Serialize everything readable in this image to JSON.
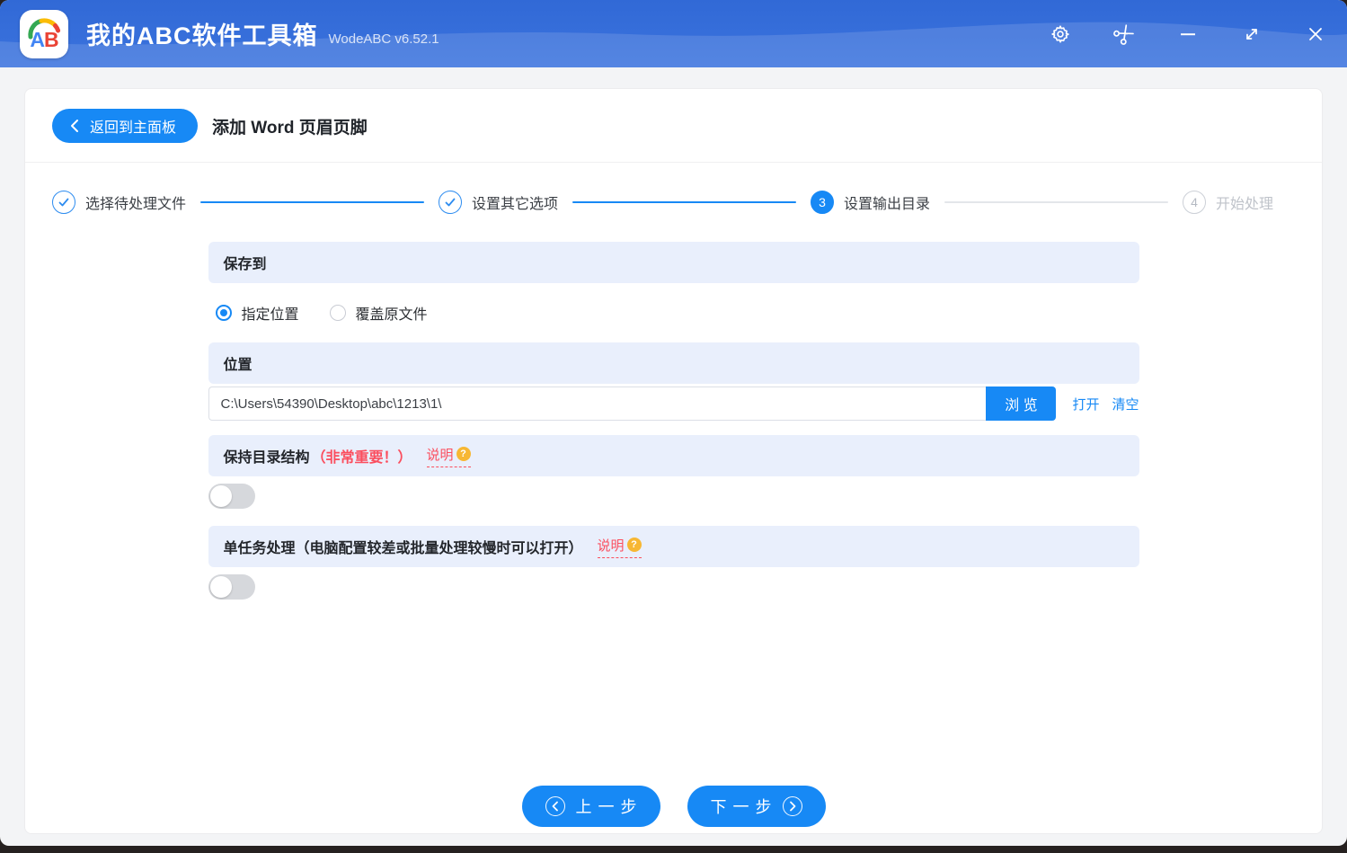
{
  "window": {
    "title": "我的ABC软件工具箱",
    "version": "WodeABC v6.52.1",
    "logo_a": "A",
    "logo_b": "B"
  },
  "titlebar": {
    "icons": [
      "settings-gear",
      "scissors-screenshot",
      "minimize",
      "resize",
      "close"
    ]
  },
  "header": {
    "back_label": "返回到主面板",
    "page_title": "添加 Word 页眉页脚"
  },
  "steps": [
    {
      "label": "选择待处理文件",
      "state": "done"
    },
    {
      "label": "设置其它选项",
      "state": "done"
    },
    {
      "label": "设置输出目录",
      "number": "3",
      "state": "active"
    },
    {
      "label": "开始处理",
      "number": "4",
      "state": "pending"
    }
  ],
  "form": {
    "save_to": {
      "title": "保存到",
      "options": [
        {
          "label": "指定位置",
          "selected": true
        },
        {
          "label": "覆盖原文件",
          "selected": false
        }
      ]
    },
    "location": {
      "title": "位置",
      "path_value": "C:\\Users\\54390\\Desktop\\abc\\1213\\1\\",
      "browse_label": "浏 览",
      "open_label": "打开",
      "clear_label": "清空"
    },
    "keep_structure": {
      "title": "保持目录结构",
      "note": "（非常重要！）",
      "help_label": "说明",
      "toggle": "off"
    },
    "single_task": {
      "title": "单任务处理（电脑配置较差或批量处理较慢时可以打开）",
      "help_label": "说明",
      "toggle": "off"
    }
  },
  "footer": {
    "prev_label": "上一步",
    "next_label": "下一步"
  },
  "colors": {
    "titlebar_blue": "#3670dc",
    "accent_blue": "#1789f5",
    "section_bg": "#e9effc",
    "danger_red": "#fb4e5e",
    "help_badge_yellow": "#f7b733"
  }
}
